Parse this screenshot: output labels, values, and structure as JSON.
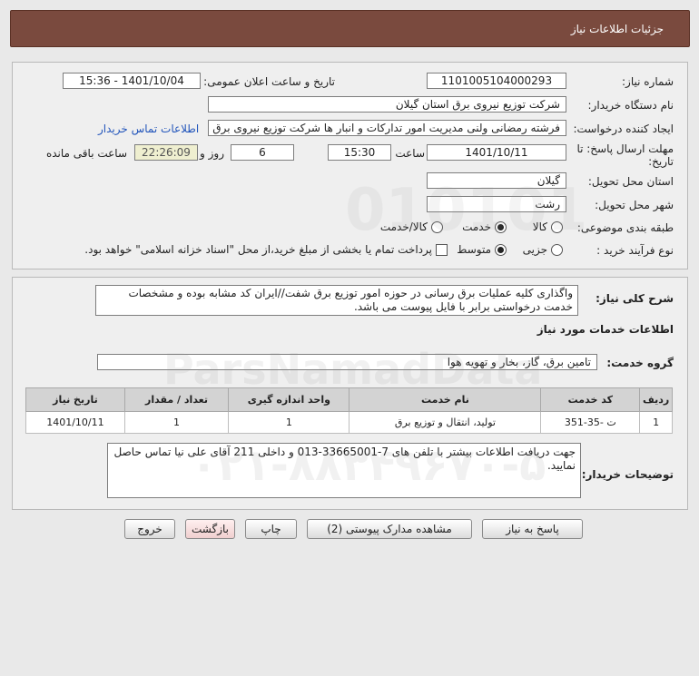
{
  "header": {
    "title": "جزئیات اطلاعات نیاز"
  },
  "form": {
    "need_number_label": "شماره نیاز:",
    "need_number": "1101005104000293",
    "announce_label": "تاریخ و ساعت اعلان عمومی:",
    "announce_value": "1401/10/04 - 15:36",
    "buyer_org_label": "نام دستگاه خریدار:",
    "buyer_org": "شرکت توزیع نیروی برق استان گیلان",
    "creator_label": "ایجاد کننده درخواست:",
    "creator": "فرشته رمضانی ولنی مدیریت امور تدارکات و انبار ها شرکت توزیع نیروی برق استان گیلان",
    "contact_link": "اطلاعات تماس خریدار",
    "deadline_label": "مهلت ارسال پاسخ: تا",
    "deadline_label2": "تاریخ:",
    "deadline_date": "1401/10/11",
    "time_label": "ساعت",
    "deadline_time": "15:30",
    "days": "6",
    "days_label": "روز و",
    "remaining": "22:26:09",
    "remaining_label": "ساعت باقی مانده",
    "province_label": "استان محل تحویل:",
    "province": "گیلان",
    "city_label": "شهر محل تحویل:",
    "city": "رشت",
    "category_label": "طبقه بندی موضوعی:",
    "category_options": [
      "کالا",
      "خدمت",
      "کالا/خدمت"
    ],
    "process_label": "نوع فرآیند خرید :",
    "process_options": [
      "جزیی",
      "متوسط"
    ],
    "payment_note": "پرداخت تمام یا بخشی از مبلغ خرید،از محل \"اسناد خزانه اسلامی\" خواهد بود."
  },
  "description": {
    "label": "شرح کلی نیاز:",
    "text": "واگذاری کلیه عملیات برق رسانی در حوزه امور توزیع برق شفت//ایران کد مشابه بوده و مشخصات خدمت درخواستی برابر با فایل پیوست می باشد."
  },
  "services": {
    "section_title": "اطلاعات خدمات مورد نیاز",
    "group_label": "گروه خدمت:",
    "group_value": "تامین برق، گاز، بخار و تهویه هوا",
    "columns": [
      "ردیف",
      "کد خدمت",
      "نام خدمت",
      "واحد اندازه گیری",
      "تعداد / مقدار",
      "تاریخ نیاز"
    ],
    "rows": [
      [
        "1",
        "ت -35-351",
        "تولید، انتقال و توزیع برق",
        "1",
        "1",
        "1401/10/11"
      ]
    ]
  },
  "buyer_notes": {
    "label": "توضیحات خریدار:",
    "text": "جهت دریافت اطلاعات بیشتر با تلفن های 7-33665001-013 و داخلی 211 آقای علی نیا تماس حاصل نمایید."
  },
  "buttons": {
    "reply": "پاسخ به نیاز",
    "attachments": "مشاهده مدارک پیوستی (2)",
    "print": "چاپ",
    "back": "بازگشت",
    "exit": "خروج"
  },
  "watermark": {
    "brand": "ParsNamadData",
    "phone": "۰۲۱-۸۸۳۴۹۶۷۰-۵"
  }
}
